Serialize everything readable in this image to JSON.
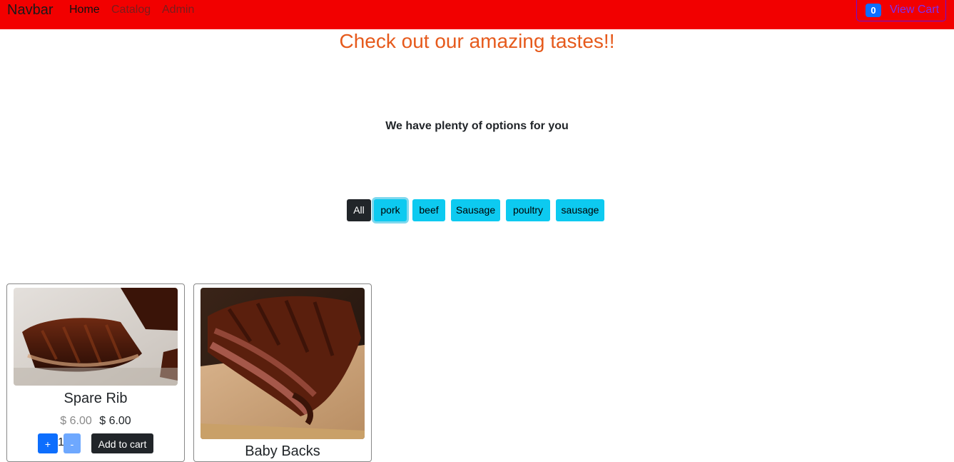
{
  "navbar": {
    "brand": "Navbar",
    "links": [
      "Home",
      "Catalog",
      "Admin"
    ],
    "cart": {
      "count": "0",
      "label": "View Cart"
    },
    "background": "#f20000"
  },
  "hero": {
    "headline": "Check out our amazing tastes!!",
    "subtitle": "We have plenty of options for you",
    "headline_color": "#e65a1c"
  },
  "filters": [
    "All",
    "pork",
    "beef",
    "Sausage",
    "poultry",
    "sausage"
  ],
  "products": [
    {
      "title": "Spare Rib",
      "old_price": "$ 6.00",
      "price": "$ 6.00",
      "plus": "+",
      "quantity": "1",
      "minus": "-",
      "add_label": "Add to cart",
      "image_icon": "ribs-photo"
    },
    {
      "title": "Baby Backs",
      "image_icon": "ribs-photo"
    }
  ]
}
